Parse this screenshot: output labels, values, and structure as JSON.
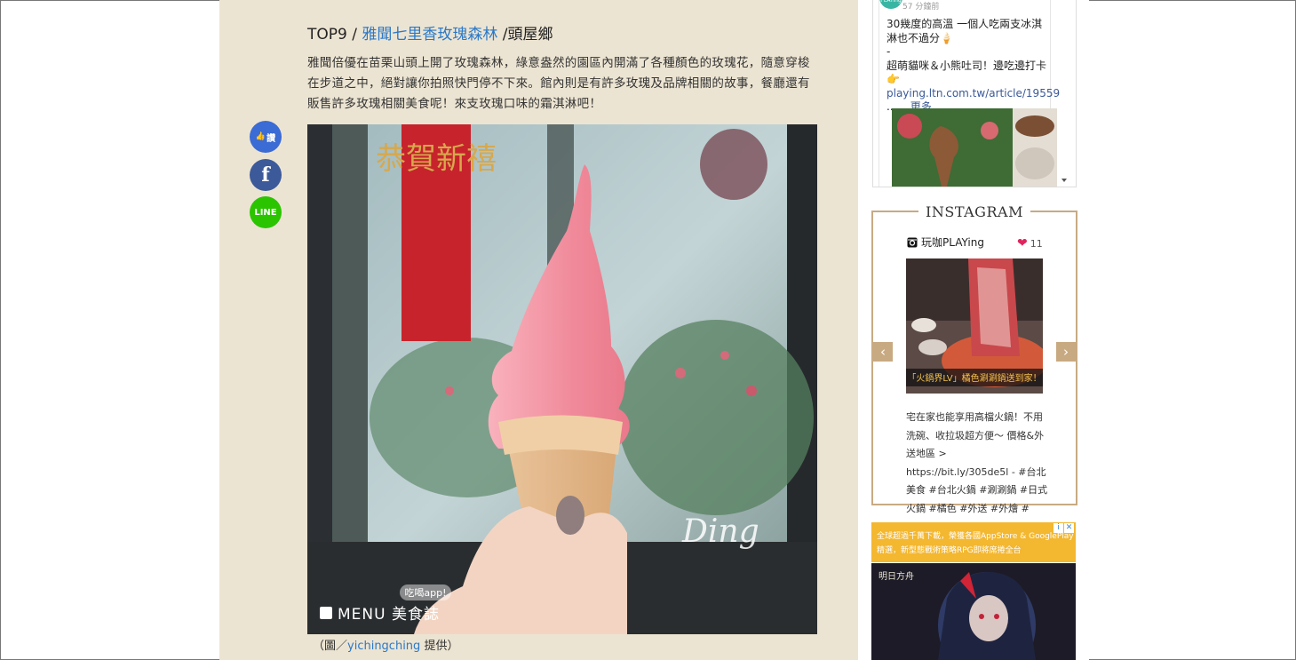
{
  "article": {
    "heading_prefix": "TOP9 / ",
    "heading_link": "雅聞七里香玫瑰森林",
    "heading_suffix": " /頭屋鄉",
    "paragraph": "雅聞倍優在苗栗山頭上開了玫瑰森林，綠意盎然的園區內開滿了各種顏色的玫瑰花，隨意穿梭在步道之中，絕對讓你拍照快門停不下來。館內則是有許多玫瑰及品牌相關的故事，餐廳還有販售許多玫瑰相關美食呢！來支玫瑰口味的霜淇淋吧！",
    "caption_prefix": "（圖／",
    "caption_link": "yichingching",
    "caption_suffix": " 提供）",
    "photo": {
      "banner_text": "恭賀新禧",
      "signature": "Ding",
      "watermark_app": "吃喝app!",
      "watermark_brand": "MENU 美食誌"
    }
  },
  "share": {
    "like_label": "讚",
    "facebook_label": "f",
    "line_label": "LINE"
  },
  "facebook_widget": {
    "avatar_label": "PLAYing",
    "time": "57 分鐘前",
    "line1": "30幾度的高溫 一個人吃兩支冰淇淋也不過分🍦",
    "line2": "-",
    "line3": "超萌貓咪＆小熊吐司！邊吃邊打卡",
    "link": "👉playing.ltn.com.tw/article/19559",
    "more_prefix": "...... ",
    "more_label": "更多"
  },
  "instagram": {
    "title": "INSTAGRAM",
    "username": "玩咖PLAYing",
    "likes": "11",
    "photo_label": "「火鍋界LV」橘色涮涮鍋送到家！",
    "caption": "宅在家也能享用高檔火鍋！不用洗碗、收拉圾超方便～ 價格&外送地區 > https://bit.ly/305de5l - #台北美食 #台北火鍋 #涮涮鍋 #日式火鍋 #橘色 #外送 #外燴 #",
    "prev_label": "‹",
    "next_label": "›"
  },
  "ad": {
    "line1": "全球超過千萬下載，榮獲各國AppStore & GooglePlay",
    "line2": "精選，新型態戰術策略RPG即將席捲全台",
    "info_icon": "i",
    "close_icon": "✕",
    "logo": "明日方舟"
  },
  "colors": {
    "article_bg": "#ece4d2",
    "link": "#2a79c9",
    "instagram_border": "#c8aa82",
    "ad_bg": "#f3b730"
  }
}
